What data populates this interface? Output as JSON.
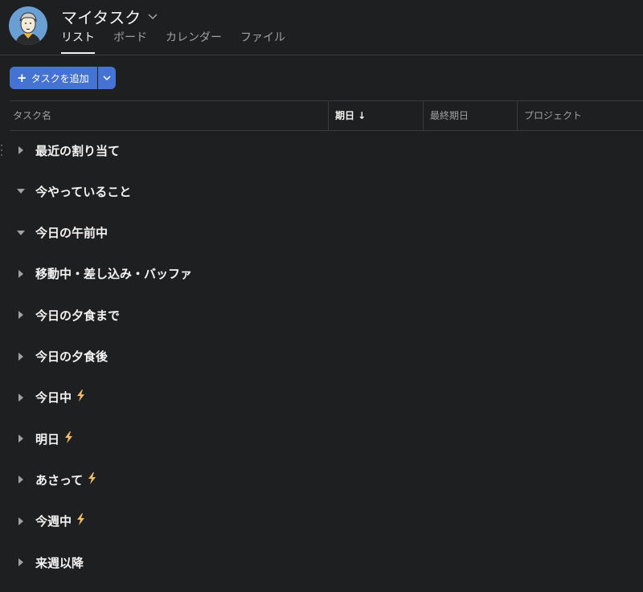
{
  "header": {
    "title": "マイタスク",
    "tabs": [
      {
        "label": "リスト",
        "active": true
      },
      {
        "label": "ボード",
        "active": false
      },
      {
        "label": "カレンダー",
        "active": false
      },
      {
        "label": "ファイル",
        "active": false
      }
    ]
  },
  "toolbar": {
    "add_task_label": "タスクを追加",
    "add_icon": "plus-icon"
  },
  "columns": {
    "task_name": "タスク名",
    "date": "期日 ↓",
    "due_date": "最終期日",
    "project": "プロジェクト"
  },
  "sections": [
    {
      "label": "最近の割り当て",
      "expanded": false,
      "bolt": false
    },
    {
      "label": "今やっていること",
      "expanded": true,
      "bolt": false
    },
    {
      "label": "今日の午前中",
      "expanded": true,
      "bolt": false
    },
    {
      "label": "移動中・差し込み・バッファ",
      "expanded": false,
      "bolt": false
    },
    {
      "label": "今日の夕食まで",
      "expanded": false,
      "bolt": false
    },
    {
      "label": "今日の夕食後",
      "expanded": false,
      "bolt": false
    },
    {
      "label": "今日中",
      "expanded": false,
      "bolt": true
    },
    {
      "label": "明日",
      "expanded": false,
      "bolt": true
    },
    {
      "label": "あさって",
      "expanded": false,
      "bolt": true
    },
    {
      "label": "今週中",
      "expanded": false,
      "bolt": true
    },
    {
      "label": "来週以降",
      "expanded": false,
      "bolt": false
    }
  ],
  "colors": {
    "background": "#1e1f21",
    "accent": "#4573d2",
    "bolt": "#f1bd6c"
  }
}
